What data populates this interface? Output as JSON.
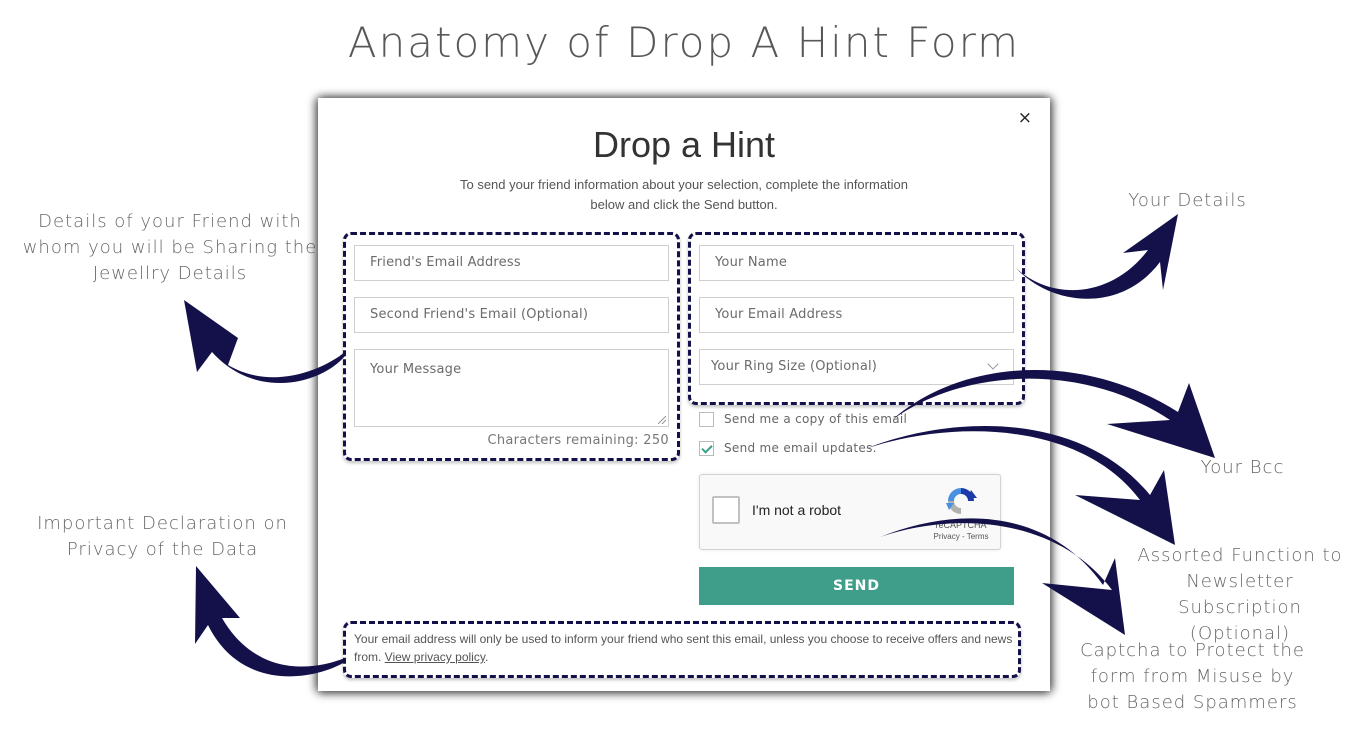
{
  "title": "Anatomy of Drop A Hint Form",
  "modal": {
    "title": "Drop a Hint",
    "subtitle": "To send your friend information about your selection, complete the information below and click the Send button.",
    "close_label": "×",
    "friend_section": {
      "friend_email_placeholder": "Friend's Email Address",
      "second_friend_email_placeholder": "Second Friend's Email (Optional)",
      "message_placeholder": "Your Message",
      "chars_remaining_label": "Characters remaining: 250",
      "chars_remaining": 250
    },
    "your_section": {
      "name_placeholder": "Your Name",
      "email_placeholder": "Your Email Address",
      "ring_size_selected": "Your Ring Size (Optional)"
    },
    "checkboxes": [
      {
        "label": "Send me a copy of this email",
        "checked": false
      },
      {
        "label": "Send me email updates.",
        "checked": true
      }
    ],
    "recaptcha": {
      "label": "I'm not a robot",
      "brand": "reCAPTCHA",
      "links": "Privacy - Terms"
    },
    "send_label": "SEND",
    "privacy_text": "Your email address will only be used to inform your friend who sent this email, unless you choose to receive offers and news from. ",
    "privacy_link": "View privacy policy",
    "privacy_end": "."
  },
  "annotations": {
    "friend_details": "Details of your Friend with whom you will be Sharing the Jewellry Details",
    "privacy": "Important Declaration on Privacy of the Data",
    "your_details": "Your Details",
    "your_bcc": "Your Bcc",
    "newsletter": "Assorted Function to Newsletter Subscription (Optional)",
    "captcha": "Captcha to Protect the form from Misuse by bot Based Spammers"
  },
  "colors": {
    "accent": "#3f9e8a",
    "annotation_arrow": "#14114a",
    "dashed_border": "#14114a"
  }
}
